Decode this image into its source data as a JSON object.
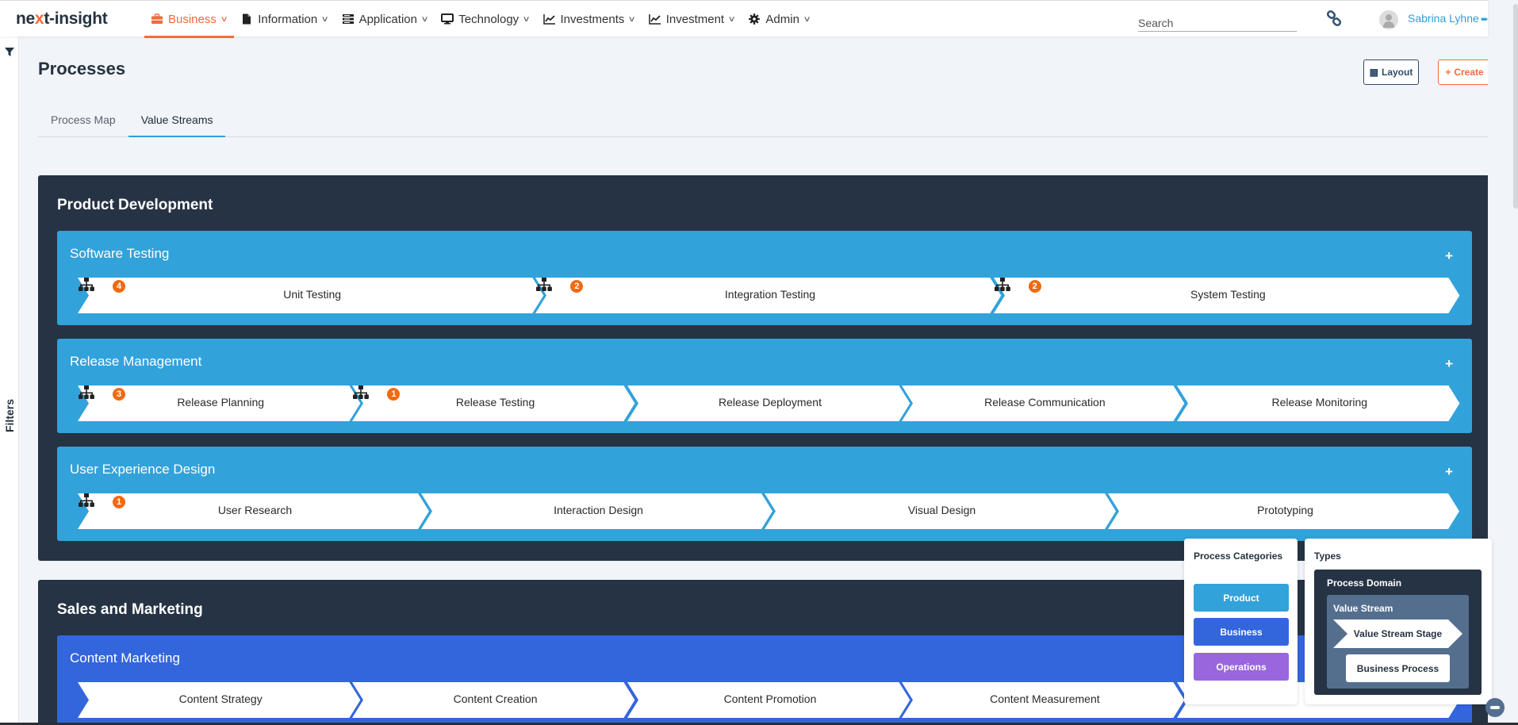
{
  "app": {
    "logo_prefix": "ne",
    "logo_x": "x",
    "logo_suffix": "t-insight"
  },
  "nav": {
    "items": [
      {
        "label": "Business",
        "icon": "briefcase-icon",
        "active": true
      },
      {
        "label": "Information",
        "icon": "file-icon",
        "active": false
      },
      {
        "label": "Application",
        "icon": "server-icon",
        "active": false
      },
      {
        "label": "Technology",
        "icon": "desktop-icon",
        "active": false
      },
      {
        "label": "Investments",
        "icon": "line-chart-icon",
        "active": false
      },
      {
        "label": "Investment",
        "icon": "line-chart-icon",
        "active": false
      },
      {
        "label": "Admin",
        "icon": "gear-icon",
        "active": false
      }
    ],
    "search_placeholder": "Search",
    "user_name": "Sabrina Lyhne"
  },
  "sidebar": {
    "filters_label": "Filters"
  },
  "page": {
    "title": "Processes",
    "layout_button": "Layout",
    "create_button": "Create",
    "tabs": [
      {
        "label": "Process Map",
        "active": false
      },
      {
        "label": "Value Streams",
        "active": true
      }
    ]
  },
  "domains": [
    {
      "title": "Product Development",
      "value_streams": [
        {
          "title": "Software Testing",
          "category": "Product",
          "stages": [
            {
              "label": "Unit Testing",
              "process_count": 4
            },
            {
              "label": "Integration Testing",
              "process_count": 2
            },
            {
              "label": "System Testing",
              "process_count": 2
            }
          ]
        },
        {
          "title": "Release Management",
          "category": "Product",
          "stages": [
            {
              "label": "Release Planning",
              "process_count": 3
            },
            {
              "label": "Release Testing",
              "process_count": 1
            },
            {
              "label": "Release Deployment",
              "process_count": null
            },
            {
              "label": "Release Communication",
              "process_count": null
            },
            {
              "label": "Release Monitoring",
              "process_count": null
            }
          ]
        },
        {
          "title": "User Experience Design",
          "category": "Product",
          "stages": [
            {
              "label": "User Research",
              "process_count": 1
            },
            {
              "label": "Interaction Design",
              "process_count": null
            },
            {
              "label": "Visual Design",
              "process_count": null
            },
            {
              "label": "Prototyping",
              "process_count": null
            }
          ]
        }
      ]
    },
    {
      "title": "Sales and Marketing",
      "value_streams": [
        {
          "title": "Content Marketing",
          "category": "Business",
          "stages": [
            {
              "label": "Content Strategy",
              "process_count": null
            },
            {
              "label": "Content Creation",
              "process_count": null
            },
            {
              "label": "Content Promotion",
              "process_count": null
            },
            {
              "label": "Content Measurement",
              "process_count": null
            },
            {
              "label": "",
              "process_count": null
            }
          ]
        }
      ]
    }
  ],
  "legend": {
    "categories_heading": "Process Categories",
    "categories": [
      {
        "label": "Product",
        "color": "#32a2da"
      },
      {
        "label": "Business",
        "color": "#3366dd"
      },
      {
        "label": "Operations",
        "color": "#9966dd"
      }
    ],
    "types_heading": "Types",
    "types": {
      "domain": "Process Domain",
      "value_stream": "Value Stream",
      "stage": "Value Stream Stage",
      "process": "Business Process"
    }
  },
  "colors": {
    "accent": "#f26b3a",
    "link": "#2f9fd8",
    "domain_bg": "#263344",
    "product": "#32a2da",
    "business": "#3366dd",
    "operations": "#9966dd",
    "badge": "#f06a12"
  }
}
